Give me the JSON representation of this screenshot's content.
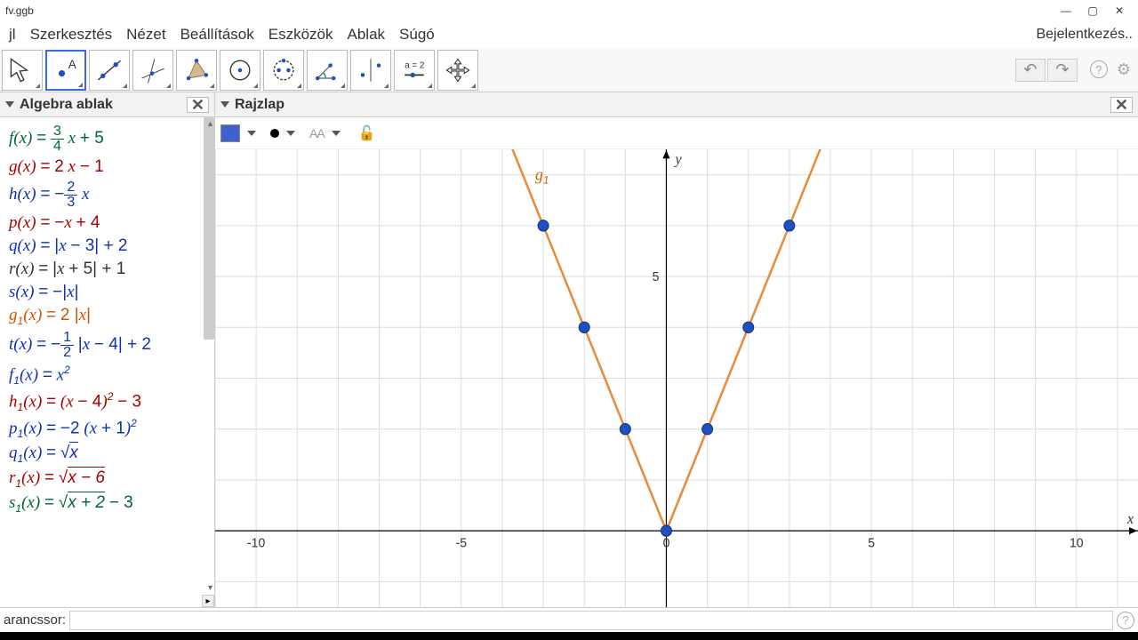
{
  "title_bar": {
    "filename": "fv.ggb"
  },
  "window_controls": {
    "min": "—",
    "max": "▢",
    "close": "✕"
  },
  "menu": [
    "jl",
    "Szerkesztés",
    "Nézet",
    "Beállítások",
    "Eszközök",
    "Ablak",
    "Súgó"
  ],
  "login_label": "Bejelentkezés..",
  "toolbar": {
    "slider_text": "a = 2"
  },
  "undo_redo": {
    "undo": "↶",
    "redo": "↷"
  },
  "panels": {
    "algebra_title": "Algebra ablak",
    "graphics_title": "Rajzlap"
  },
  "algebra": [
    {
      "color": "#006633",
      "html": "f(x) <span class='op'>=</span> <span class='frac'><span class='num'>3</span><span class='den'>4</span></span> x <span class='op'>+ 5</span>"
    },
    {
      "color": "#aa0000",
      "html": "g(x) <span class='op'>=</span> <span class='op'>2</span> x <span class='op'>− 1</span>"
    },
    {
      "color": "#1030b0",
      "html": "h(x) <span class='op'>=</span> <span class='op'>−</span><span class='frac'><span class='num'>2</span><span class='den'>3</span></span> x"
    },
    {
      "color": "#aa0000",
      "html": "p(x) <span class='op'>=</span> <span class='op'>−</span>x <span class='op'>+ 4</span>"
    },
    {
      "color": "#1030b0",
      "html": "q(x) <span class='op'>=</span> <span class='op'>|</span>x <span class='op'>− 3| + 2</span>"
    },
    {
      "color": "#333333",
      "html": "r(x) <span class='op'>=</span> <span class='op'>|</span>x <span class='op'>+ 5| + 1</span>"
    },
    {
      "color": "#1030b0",
      "html": "s(x) <span class='op'>=</span> <span class='op'>−|</span>x<span class='op'>|</span>"
    },
    {
      "color": "#cc5500",
      "html": "g<span class='sub'>1</span>(x) <span class='op'>=</span> <span class='op'>2 |</span>x<span class='op'>|</span>"
    },
    {
      "color": "#1030b0",
      "html": "t(x) <span class='op'>=</span> <span class='op'>−</span><span class='frac'><span class='num'>1</span><span class='den'>2</span></span> <span class='op'>|</span>x <span class='op'>− 4| + 2</span>"
    },
    {
      "color": "#1030b0",
      "html": "f<span class='sub'>1</span>(x) <span class='op'>=</span> x<span class='sup'>2</span>"
    },
    {
      "color": "#aa0000",
      "html": "h<span class='sub'>1</span>(x) <span class='op'>=</span> (x <span class='op'>− 4</span>)<span class='sup'>2</span> <span class='op'>− 3</span>"
    },
    {
      "color": "#1030b0",
      "html": "p<span class='sub'>1</span>(x) <span class='op'>=</span> <span class='op'>−2</span> (x <span class='op'>+ 1</span>)<span class='sup'>2</span>"
    },
    {
      "color": "#1030b0",
      "html": "q<span class='sub'>1</span>(x) <span class='op'>=</span> <span class='op'>√</span><span style='border-top:1.2px solid currentColor;padding-top:1px'>x</span>"
    },
    {
      "color": "#aa0000",
      "html": "r<span class='sub'>1</span>(x) <span class='op'>=</span> <span class='op'>√</span><span style='border-top:1.2px solid currentColor;padding-top:1px'>x − 6</span>"
    },
    {
      "color": "#006633",
      "html": "s<span class='sub'>1</span>(x) <span class='op'>=</span> <span class='op'>√</span><span style='border-top:1.2px solid currentColor;padding-top:1px'>x + 2</span> <span class='op'>− 3</span>"
    }
  ],
  "graphics_toolbar": {
    "text_size_label": "AA"
  },
  "input_bar": {
    "label": "arancssor:",
    "placeholder": ""
  },
  "chart_data": {
    "type": "line",
    "title": "",
    "xlabel": "x",
    "ylabel": "y",
    "xlim": [
      -11,
      11.5
    ],
    "ylim": [
      -1.5,
      7.5
    ],
    "xticks": [
      -10,
      -5,
      0,
      5,
      10
    ],
    "yticks": [
      5
    ],
    "series": [
      {
        "name": "g₁",
        "color": "#e88b3a",
        "formula": "2|x|",
        "points_x": [
          -5,
          5
        ],
        "points_y": [
          10,
          10
        ]
      }
    ],
    "label_pos": {
      "name": "g₁",
      "x": -3.2,
      "y": 6.9
    },
    "scatter": {
      "color": "#2050c0",
      "points": [
        {
          "x": -3,
          "y": 6
        },
        {
          "x": -2,
          "y": 4
        },
        {
          "x": -1,
          "y": 2
        },
        {
          "x": 0,
          "y": 0
        },
        {
          "x": 1,
          "y": 2
        },
        {
          "x": 2,
          "y": 4
        },
        {
          "x": 3,
          "y": 6
        }
      ]
    }
  }
}
